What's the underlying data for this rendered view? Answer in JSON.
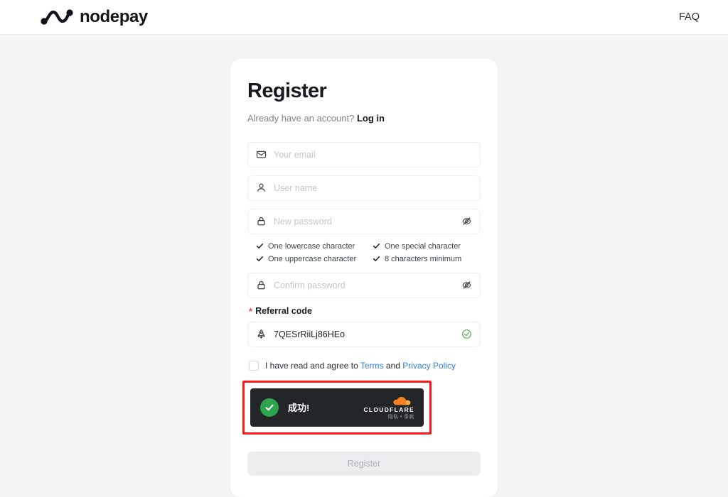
{
  "header": {
    "brand_name": "nodepay",
    "logo_icon": "nodepay-wave-logo",
    "faq_label": "FAQ"
  },
  "card": {
    "title": "Register",
    "subtitle_text": "Already have an account?",
    "login_label": "Log in",
    "fields": {
      "email": {
        "placeholder": "Your email",
        "value": "",
        "icon": "envelope-icon"
      },
      "username": {
        "placeholder": "User name",
        "value": "",
        "icon": "user-icon"
      },
      "password": {
        "placeholder": "New password",
        "value": "",
        "icon": "lock-icon",
        "toggle_icon": "eye-off-icon"
      },
      "confirm_password": {
        "placeholder": "Confirm password",
        "value": "",
        "icon": "lock-icon",
        "toggle_icon": "eye-off-icon"
      },
      "referral": {
        "label": "Referral code",
        "required_mark": "*",
        "placeholder": "Referral code",
        "value": "7QESrRiiLj86HEo",
        "icon": "rocket-icon",
        "status_icon": "circle-check-icon"
      }
    },
    "password_rules": [
      "One lowercase character",
      "One special character",
      "One uppercase character",
      "8 characters minimum"
    ],
    "terms": {
      "checked": false,
      "prefix": "I have read and agree to",
      "terms_label": "Terms",
      "conjunction": "and",
      "privacy_label": "Privacy Policy"
    },
    "turnstile": {
      "status_text": "成功!",
      "status_icon": "check-circle-icon",
      "brand_icon": "cloudflare-cloud-icon",
      "brand_label": "CLOUDFLARE",
      "brand_sub": "隐私 • 条款",
      "highlighted": true
    },
    "submit_label": "Register"
  },
  "colors": {
    "page_bg": "#f3f4f6",
    "card_bg": "#ffffff",
    "link_blue": "#2f7fe0",
    "required_red": "#e5484d",
    "highlight_red": "#ff1a1a",
    "success_green": "#2ea44f",
    "cloudflare_orange": "#f6821f",
    "disabled_button_bg": "#ececee"
  }
}
